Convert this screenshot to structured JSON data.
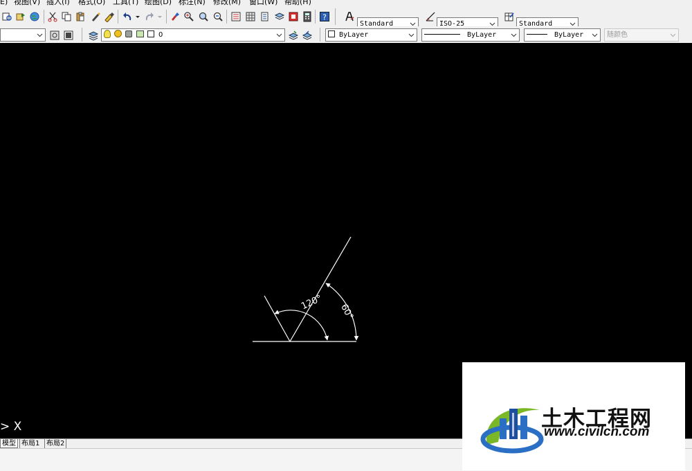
{
  "menubar": {
    "items": [
      {
        "label": "视图(V)"
      },
      {
        "label": "插入(I)"
      },
      {
        "label": "格式(O)"
      },
      {
        "label": "工具(T)"
      },
      {
        "label": "绘图(D)"
      },
      {
        "label": "标注(N)"
      },
      {
        "label": "修改(M)"
      },
      {
        "label": "窗口(W)"
      },
      {
        "label": "帮助(H)"
      }
    ]
  },
  "styles_toolbar": {
    "text_style": "Standard",
    "dim_style": "ISO-25",
    "table_style": "Standard"
  },
  "layers_toolbar": {
    "current_layer": "0"
  },
  "properties_toolbar": {
    "color": "ByLayer",
    "linetype": "ByLayer",
    "lineweight": "ByLayer",
    "plot_style": "随颜色"
  },
  "drawing": {
    "angle_labels": {
      "obtuse": "120°",
      "acute": "60°"
    }
  },
  "command_line": {
    "prompt": "> X"
  },
  "layout_tabs": [
    {
      "label": "模型",
      "active": true
    },
    {
      "label": "布局1",
      "active": false
    },
    {
      "label": "布局2",
      "active": false
    }
  ],
  "watermark": {
    "title": "土木工程网",
    "url": "www.civilcn.com",
    "colors": {
      "blue": "#2a6fc4",
      "green": "#7ab827",
      "dark_blue": "#1d4f9e"
    }
  }
}
